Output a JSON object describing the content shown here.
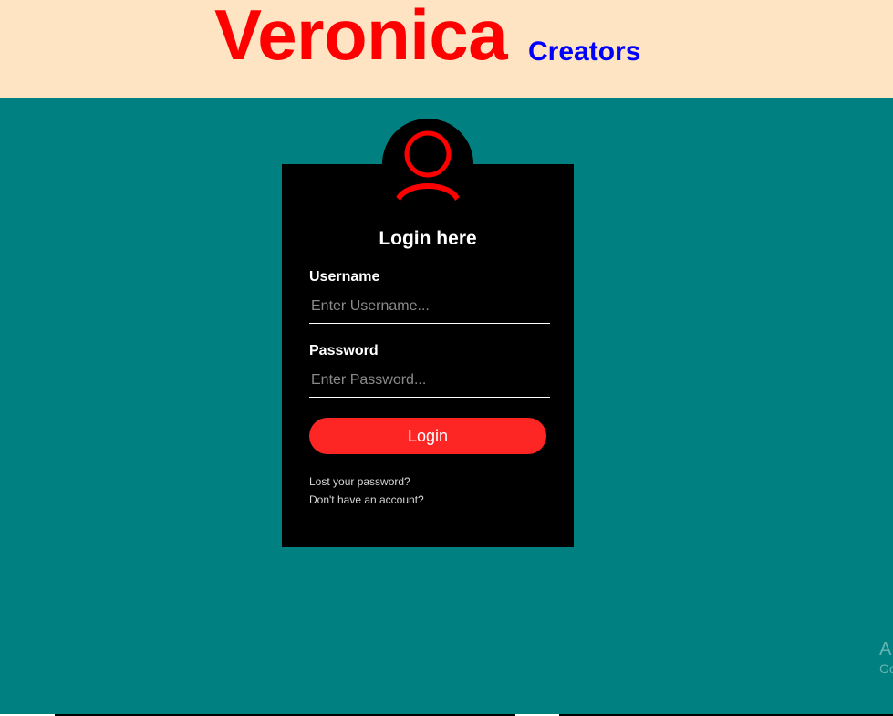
{
  "header": {
    "brand_main": "Veronica",
    "brand_sub": "Creators"
  },
  "login_card": {
    "title": "Login here",
    "username_label": "Username",
    "username_placeholder": "Enter Username...",
    "password_label": "Password",
    "password_placeholder": "Enter Password...",
    "login_button": "Login",
    "lost_password_link": "Lost your password?",
    "no_account_link": "Don't have an account?",
    "avatar_icon": "user-icon"
  },
  "watermark": {
    "line1": "A",
    "line2": "Go"
  },
  "colors": {
    "page_background": "#008080",
    "header_background": "#ffe4c4",
    "brand_main": "#ff0000",
    "brand_sub": "#0000ff",
    "card_background": "#000000",
    "accent": "#fe2525"
  }
}
